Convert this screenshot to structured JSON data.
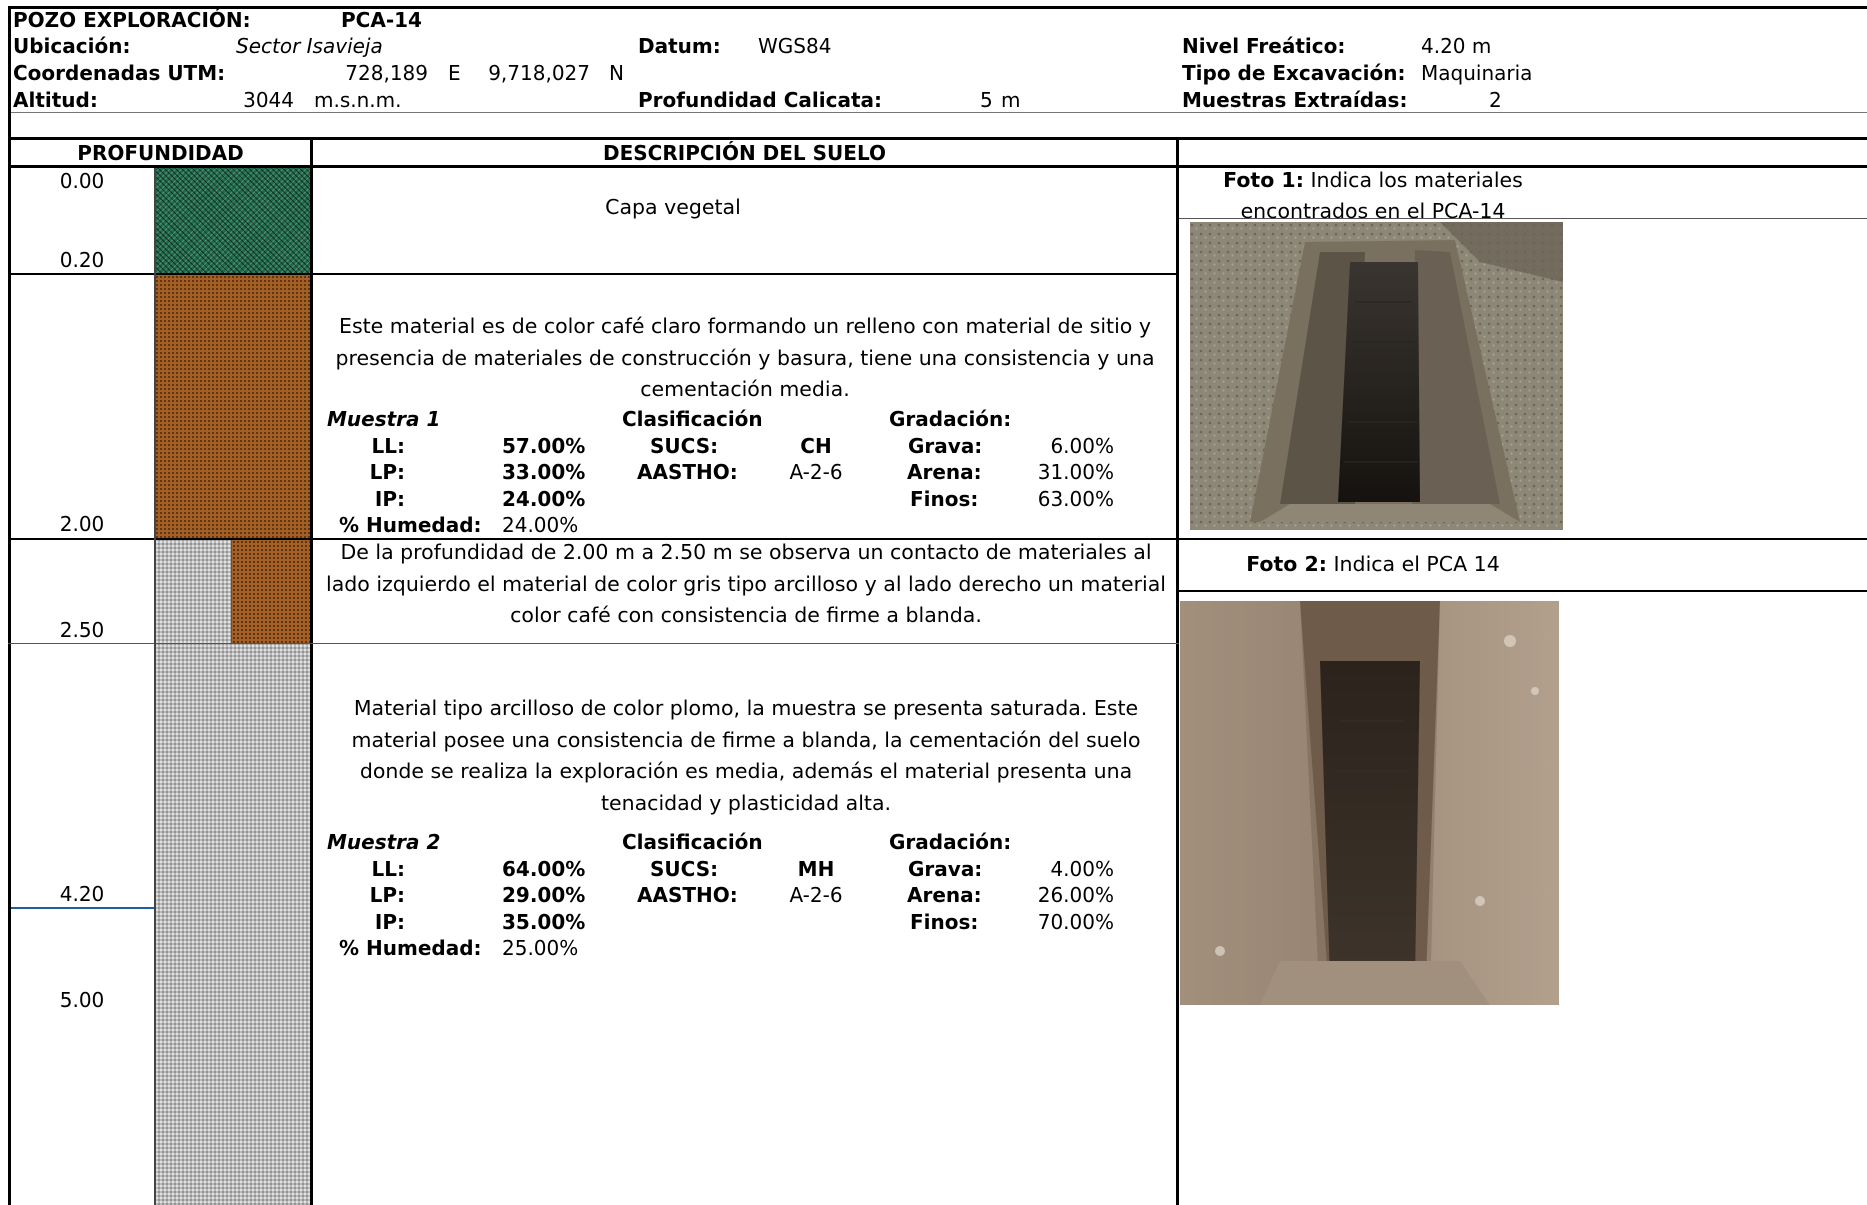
{
  "header": {
    "pozo_label": "POZO EXPLORACIÓN:",
    "pozo_value": "PCA-14",
    "ubicacion_label": "Ubicación:",
    "ubicacion_value": "Sector Isavieja",
    "datum_label": "Datum:",
    "datum_value": "WGS84",
    "nivel_label": "Nivel Freático:",
    "nivel_value": "4.20 m",
    "coord_label": "Coordenadas UTM:",
    "coord_e": "728,189",
    "coord_e_unit": "E",
    "coord_n": "9,718,027",
    "coord_n_unit": "N",
    "excav_label": "Tipo de Excavación:",
    "excav_value": "Maquinaria",
    "altitud_label": "Altitud:",
    "altitud_value": "3044",
    "altitud_unit": "m.s.n.m.",
    "prof_label": "Profundidad Calicata:",
    "prof_value": "5",
    "prof_unit": "m",
    "muestras_label": "Muestras Extraídas:",
    "muestras_value": "2"
  },
  "columns": {
    "profundidad": "PROFUNDIDAD",
    "descripcion": "DESCRIPCIÓN DEL SUELO"
  },
  "depths": {
    "d0": "0.00",
    "d1": "0.20",
    "d2": "2.00",
    "d3": "2.50",
    "d4": "4.20",
    "d5": "5.00"
  },
  "layers": {
    "capa1": "Capa vegetal",
    "capa2": "Este material es de color café claro formando un relleno con material de sitio y presencia de materiales de construcción y basura, tiene una consistencia y una cementación media.",
    "capa3": "De la profundidad de 2.00 m a 2.50 m se observa un contacto de materiales al lado izquierdo el material de color gris tipo arcilloso y al lado derecho un material color café con consistencia de firme a blanda.",
    "capa4": "Material tipo arcilloso de color plomo, la muestra se presenta saturada. Este material posee una consistencia de firme a blanda, la cementación del suelo donde se realiza la exploración es media, además el material presenta una tenacidad y plasticidad alta."
  },
  "samples": [
    {
      "title": "Muestra 1",
      "ll_label": "LL:",
      "ll": "57.00%",
      "lp_label": "LP:",
      "lp": "33.00%",
      "ip_label": "IP:",
      "ip": "24.00%",
      "hum_label": "% Humedad:",
      "hum": "24.00%",
      "clas_label": "Clasificación",
      "sucs_label": "SUCS:",
      "sucs": "CH",
      "aastho_label": "AASTHO:",
      "aastho": "A-2-6",
      "grad_label": "Gradación:",
      "grava_label": "Grava:",
      "grava": "6.00%",
      "arena_label": "Arena:",
      "arena": "31.00%",
      "finos_label": "Finos:",
      "finos": "63.00%"
    },
    {
      "title": "Muestra 2",
      "ll_label": "LL:",
      "ll": "64.00%",
      "lp_label": "LP:",
      "lp": "29.00%",
      "ip_label": "IP:",
      "ip": "35.00%",
      "hum_label": "% Humedad:",
      "hum": "25.00%",
      "clas_label": "Clasificación",
      "sucs_label": "SUCS:",
      "sucs": "MH",
      "aastho_label": "AASTHO:",
      "aastho": "A-2-6",
      "grad_label": "Gradación:",
      "grava_label": "Grava:",
      "grava": "4.00%",
      "arena_label": "Arena:",
      "arena": "26.00%",
      "finos_label": "Finos:",
      "finos": "70.00%"
    }
  ],
  "photos": {
    "foto1_label": "Foto 1:",
    "foto1_text": "Indica los materiales encontrados en el PCA-14",
    "foto2_label": "Foto 2:",
    "foto2_text": "Indica el PCA 14"
  },
  "colors": {
    "vegetal": "#1f6b4b",
    "cafe": "#a35f24",
    "gris": "#b9b9b9",
    "nivel_freatico_line": "#1f5fa0"
  }
}
